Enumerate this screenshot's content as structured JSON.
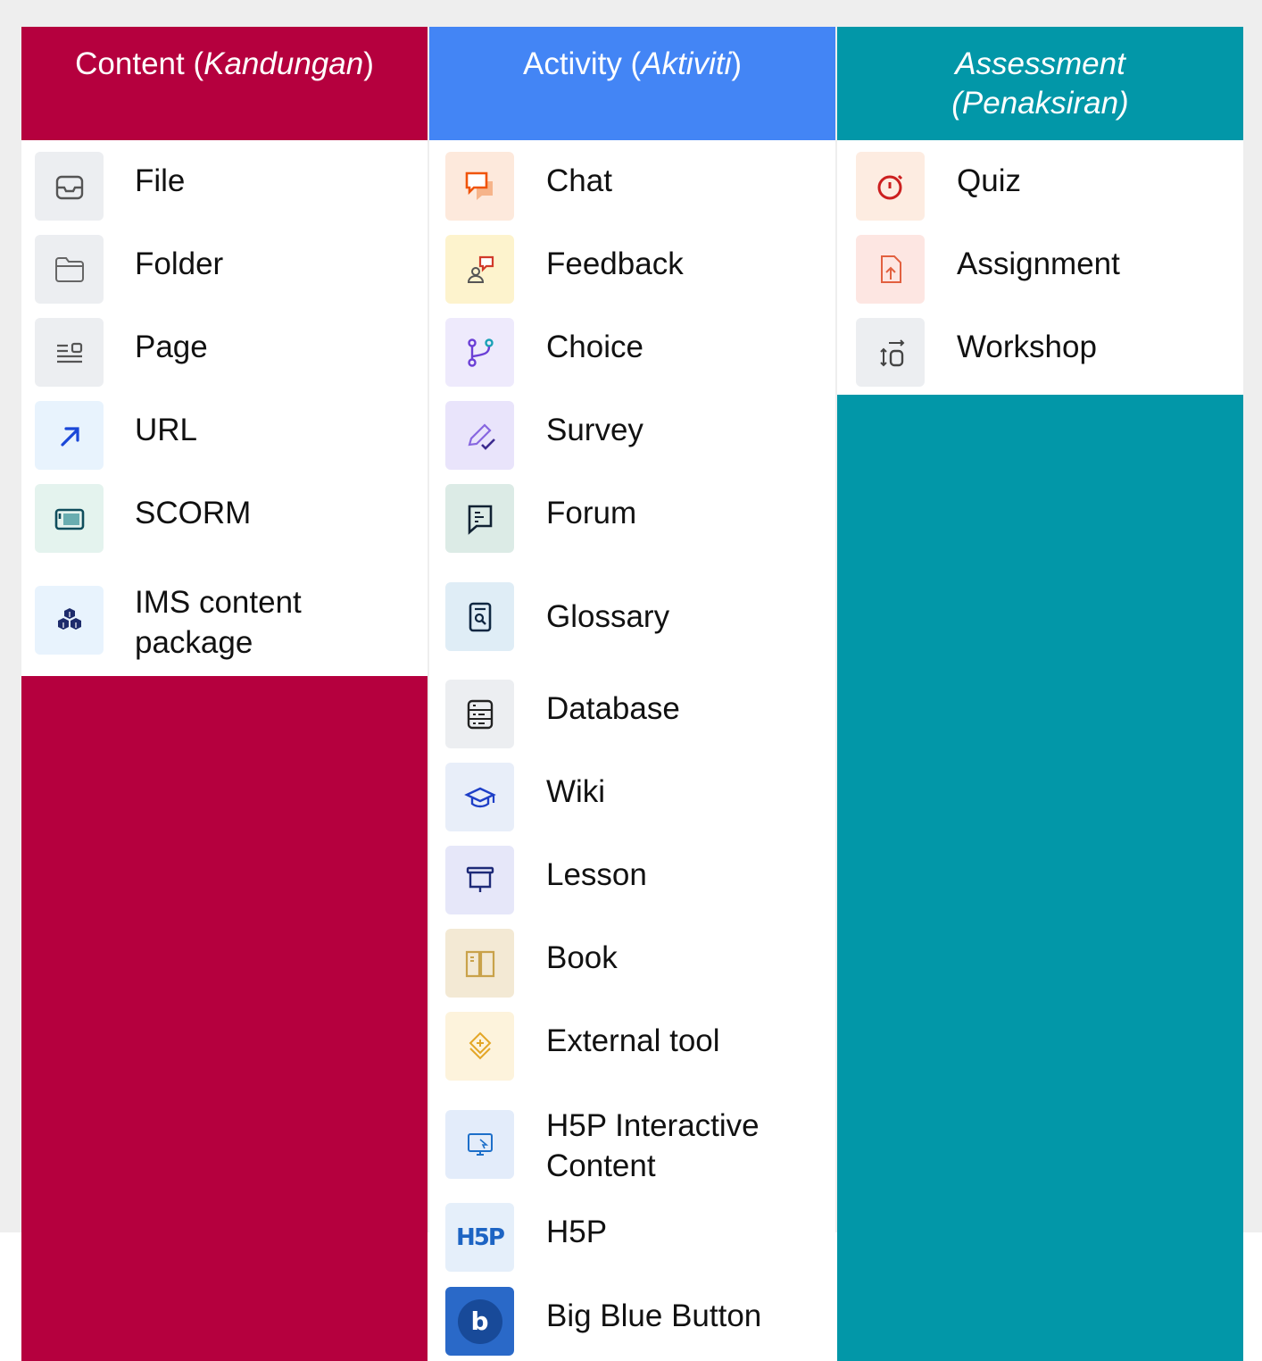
{
  "columns": {
    "content": {
      "title_plain": "Content (",
      "title_italic": "Kandungan",
      "title_end": ")",
      "items": [
        {
          "label": "File",
          "icon": "inbox-tray-icon"
        },
        {
          "label": "Folder",
          "icon": "folder-icon"
        },
        {
          "label": "Page",
          "icon": "page-lines-icon"
        },
        {
          "label": "URL",
          "icon": "arrow-up-right-icon"
        },
        {
          "label": "SCORM",
          "icon": "scorm-package-icon"
        },
        {
          "label_line1": "IMS content",
          "label_line2": "package",
          "icon": "cubes-icon"
        }
      ]
    },
    "activity": {
      "title_plain": "Activity (",
      "title_italic": "Aktiviti",
      "title_end": ")",
      "items": [
        {
          "label": "Chat",
          "icon": "chat-bubbles-icon"
        },
        {
          "label": "Feedback",
          "icon": "person-feedback-icon"
        },
        {
          "label": "Choice",
          "icon": "branch-choice-icon"
        },
        {
          "label": "Survey",
          "icon": "pencil-check-icon"
        },
        {
          "label": "Forum",
          "icon": "forum-bubble-icon"
        },
        {
          "label": "Glossary",
          "icon": "glossary-search-icon"
        },
        {
          "label": "Database",
          "icon": "database-icon"
        },
        {
          "label": "Wiki",
          "icon": "graduation-cap-icon"
        },
        {
          "label": "Lesson",
          "icon": "presentation-board-icon"
        },
        {
          "label": "Book",
          "icon": "open-book-icon"
        },
        {
          "label": "External tool",
          "icon": "puzzle-diamond-icon"
        },
        {
          "label_line1": "H5P Interactive",
          "label_line2": "Content",
          "icon": "monitor-cursor-icon"
        },
        {
          "label": "H5P",
          "icon": "h5p-logo-icon",
          "logo_text": "H5P"
        },
        {
          "label": "Big Blue Button",
          "icon": "bigbluebutton-logo-icon",
          "logo_text": "b"
        }
      ]
    },
    "assessment": {
      "title_line1": "Assessment",
      "title_line2": "(Penaksiran)",
      "items": [
        {
          "label": "Quiz",
          "icon": "stopwatch-icon"
        },
        {
          "label": "Assignment",
          "icon": "file-upload-icon"
        },
        {
          "label": "Workshop",
          "icon": "workshop-arrows-icon"
        }
      ]
    }
  },
  "colors": {
    "content": "#b5003e",
    "activity": "#4385f5",
    "assessment": "#0297a8"
  }
}
